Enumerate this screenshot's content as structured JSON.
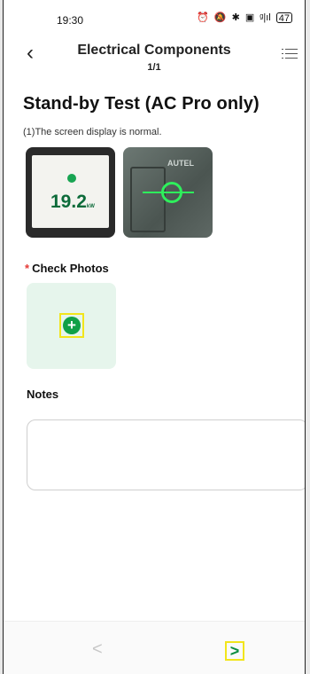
{
  "status_bar": {
    "time": "19:30",
    "icons": [
      "alarm-icon",
      "mute-icon",
      "bluetooth-icon",
      "nfc-icon",
      "signal-icon"
    ],
    "signal_text": "ᵍ|ıl",
    "battery": "47"
  },
  "header": {
    "title": "Electrical Components",
    "subtitle": "1/1"
  },
  "section": {
    "title": "Stand-by Test (AC Pro only)",
    "description": "(1)The screen display is normal."
  },
  "thumbnails": {
    "first_value": "19.2",
    "first_unit": "kW",
    "second_brand": "AUTEL"
  },
  "check_photos": {
    "required_mark": "*",
    "label": "Check Photos",
    "add_symbol": "+"
  },
  "notes": {
    "label": "Notes",
    "value": ""
  },
  "nav": {
    "prev_symbol": "<",
    "next_symbol": ">"
  },
  "colors": {
    "accent_green": "#10a047",
    "highlight_yellow": "#f2e51b",
    "upload_bg": "#e6f5ec",
    "required_red": "#e53935"
  }
}
